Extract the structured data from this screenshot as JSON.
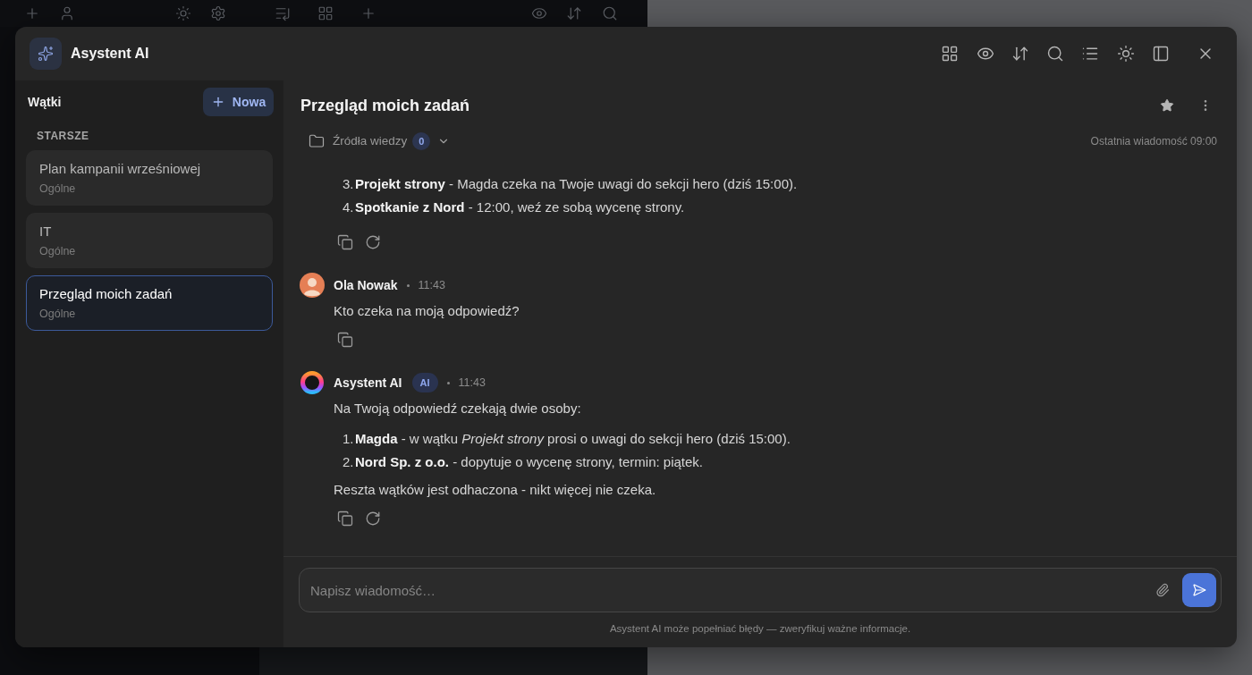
{
  "window": {
    "title": "Asystent AI"
  },
  "sidebar": {
    "title": "Wątki",
    "new_button": "Nowa",
    "section": "STARSZE",
    "threads": [
      {
        "title": "Plan kampanii wrześniowej",
        "category": "Ogólne",
        "selected": false
      },
      {
        "title": "IT",
        "category": "Ogólne",
        "selected": false
      },
      {
        "title": "Przegląd moich zadań",
        "category": "Ogólne",
        "selected": true
      }
    ]
  },
  "chat": {
    "title": "Przegląd moich zadań",
    "sources": {
      "label": "Źródła wiedzy",
      "count": "0"
    },
    "last_message": "Ostatnia wiadomość 09:00",
    "messages": [
      {
        "kind": "assistant",
        "blocks": [
          {
            "kind": "list",
            "items": [
              {
                "number": "3.",
                "text": "**Projekt strony** - Magda czeka na Twoje uwagi do sekcji hero (dziś 15:00)."
              },
              {
                "number": "4.",
                "text": "**Spotkanie z Nord** - 12:00, weź ze sobą wycenę strony."
              }
            ]
          }
        ]
      },
      {
        "kind": "user",
        "name": "Ola Nowak",
        "time": "11:43",
        "blocks": [
          {
            "kind": "paragraph",
            "text": "Kto czeka na moją odpowiedź?"
          }
        ]
      },
      {
        "kind": "assistant",
        "name": "Asystent AI",
        "badge": "AI",
        "time": "11:43",
        "blocks": [
          {
            "kind": "paragraph",
            "text": "Na Twoją odpowiedź czekają dwie osoby:"
          },
          {
            "kind": "list",
            "items": [
              {
                "number": "1.",
                "text": "**Magda** - w wątku *Projekt strony* prosi o uwagi do sekcji hero (dziś 15:00)."
              },
              {
                "number": "2.",
                "text": "**Nord Sp. z o.o.** - dopytuje o wycenę strony, termin: piątek."
              }
            ]
          },
          {
            "kind": "paragraph",
            "text": "Reszta wątków jest odhaczona - nikt więcej nie czeka."
          }
        ]
      }
    ]
  },
  "composer": {
    "placeholder": "Napisz wiadomość…",
    "disclaimer": "Asystent AI może popełniać błędy — zweryfikuj ważne informacje."
  }
}
